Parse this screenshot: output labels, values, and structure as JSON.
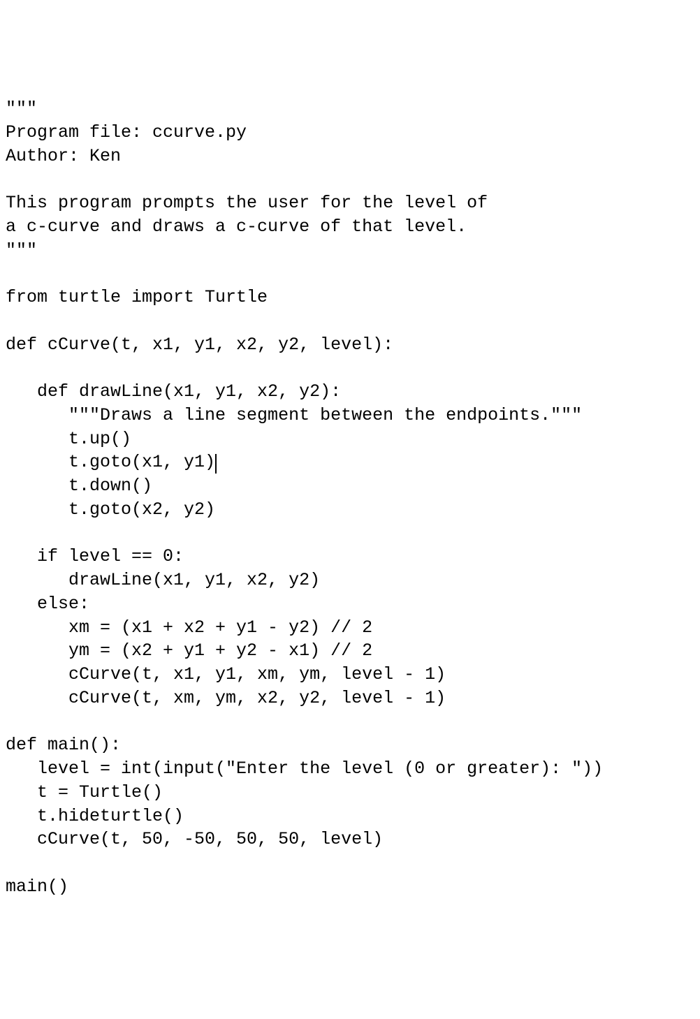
{
  "code": {
    "line1": "\"\"\"",
    "line2": "Program file: ccurve.py",
    "line3": "Author: Ken",
    "line4": "",
    "line5": "This program prompts the user for the level of",
    "line6": "a c-curve and draws a c-curve of that level.",
    "line7": "\"\"\"",
    "line8": "",
    "line9": "from turtle import Turtle",
    "line10": "",
    "line11": "def cCurve(t, x1, y1, x2, y2, level):",
    "line12": "",
    "line13": "   def drawLine(x1, y1, x2, y2):",
    "line14": "      \"\"\"Draws a line segment between the endpoints.\"\"\"",
    "line15": "      t.up()",
    "line16a": "      t.goto(x1, y1)",
    "line17": "      t.down()",
    "line18": "      t.goto(x2, y2)",
    "line19": "",
    "line20": "   if level == 0:",
    "line21": "      drawLine(x1, y1, x2, y2)",
    "line22": "   else:",
    "line23": "      xm = (x1 + x2 + y1 - y2) // 2",
    "line24": "      ym = (x2 + y1 + y2 - x1) // 2",
    "line25": "      cCurve(t, x1, y1, xm, ym, level - 1)",
    "line26": "      cCurve(t, xm, ym, x2, y2, level - 1)",
    "line27": "",
    "line28": "def main():",
    "line29": "   level = int(input(\"Enter the level (0 or greater): \"))",
    "line30": "   t = Turtle()",
    "line31": "   t.hideturtle()",
    "line32": "   cCurve(t, 50, -50, 50, 50, level)",
    "line33": "",
    "line34": "main()"
  }
}
